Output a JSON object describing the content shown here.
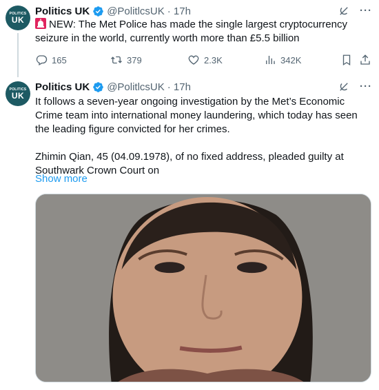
{
  "tweets": [
    {
      "avatar": {
        "small_text": "POLITICS",
        "big_text": "UK"
      },
      "author": {
        "name": "Politics UK",
        "handle": "@PolitlcsUK",
        "time": "· 17h"
      },
      "text": "NEW: The Met Police has made the single largest cryptocurrency seizure in the world, currently worth more than £5.5 billion",
      "stats": {
        "replies": "165",
        "retweets": "379",
        "likes": "2.3K",
        "views": "342K"
      }
    },
    {
      "avatar": {
        "small_text": "POLITICS",
        "big_text": "UK"
      },
      "author": {
        "name": "Politics UK",
        "handle": "@PolitlcsUK",
        "time": "· 17h"
      },
      "text_para1": "It follows a seven-year ongoing investigation by the Met’s Economic Crime team into international money laundering, which today has seen the leading figure convicted for her crimes.",
      "text_para2": "Zhimin Qian, 45 (04.09.1978), of no fixed address, pleaded guilty at Southwark Crown Court on",
      "show_more": "Show more"
    }
  ],
  "colors": {
    "accent": "#1d9bf0",
    "muted": "#536471",
    "avatar_bg": "#1d5a63",
    "siren": "#e0245e"
  },
  "icons": [
    "siren-icon",
    "verified-icon",
    "grok-icon",
    "more-icon",
    "reply-icon",
    "retweet-icon",
    "like-icon",
    "views-icon",
    "bookmark-icon",
    "share-icon"
  ]
}
